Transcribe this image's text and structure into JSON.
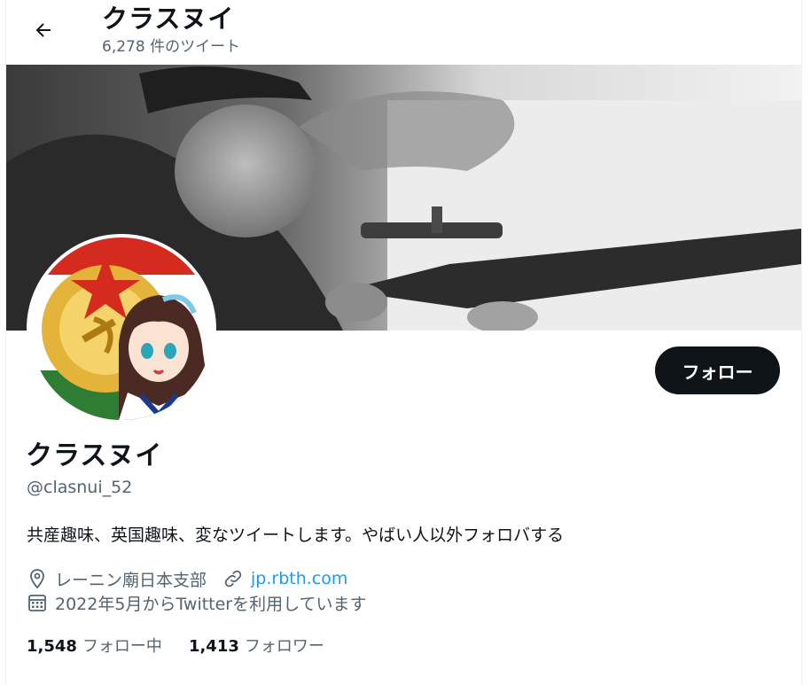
{
  "header": {
    "title": "クラスヌイ",
    "tweet_count": "6,278 件のツイート"
  },
  "profile": {
    "display_name": "クラスヌイ",
    "handle": "@clasnui_52",
    "bio": "共産趣味、英国趣味、変なツイートします。やばい人以外フォロバする",
    "location": "レーニン廟日本支部",
    "website": "jp.rbth.com",
    "joined": "2022年5月からTwitterを利用しています",
    "follow_button": "フォロー"
  },
  "stats": {
    "following_count": "1,548",
    "following_label": "フォロー中",
    "followers_count": "1,413",
    "followers_label": "フォロワー"
  },
  "colors": {
    "text_primary": "#0f1419",
    "text_secondary": "#536471",
    "link": "#1d9bf0",
    "button_bg": "#0f1419"
  },
  "icons": {
    "back": "arrow-left-icon",
    "location": "location-pin-icon",
    "link": "link-icon",
    "calendar": "calendar-icon"
  }
}
